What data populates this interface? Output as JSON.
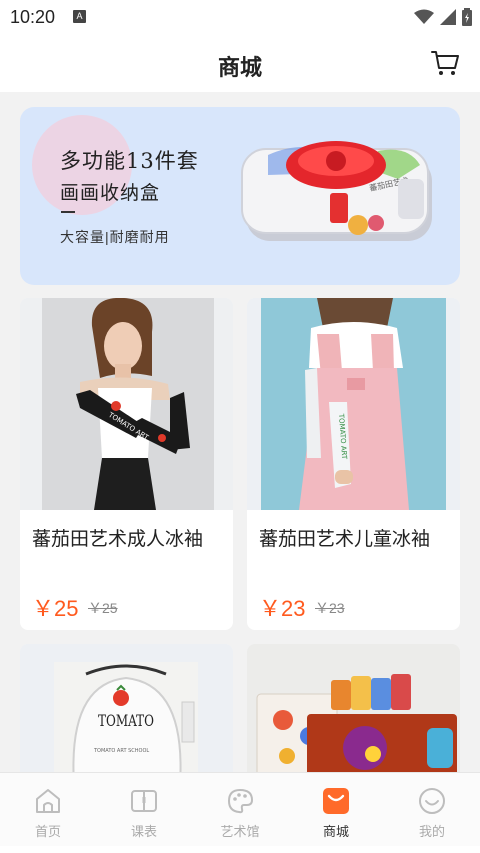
{
  "status_bar": {
    "time": "10:20",
    "badge": "A"
  },
  "header": {
    "title": "商城",
    "cart_icon": "cart-icon"
  },
  "banner": {
    "title_line1": "多功能13件套",
    "title_line2": "画画收纳盒",
    "subtitle": "大容量|耐磨耐用",
    "product_label": "蕃茄田艺术"
  },
  "products": [
    {
      "name": "蕃茄田艺术成人冰袖",
      "price": "￥25",
      "old_price": "￥25",
      "image_text": "TOMATO ART"
    },
    {
      "name": "蕃茄田艺术儿童冰袖",
      "price": "￥23",
      "old_price": "￥23",
      "image_text": "TOMATO ART"
    },
    {
      "name": "",
      "price": "",
      "old_price": "",
      "image_text": "TOMATO",
      "image_subtext": "TOMATO ART SCHOOL"
    },
    {
      "name": "",
      "price": "",
      "old_price": "",
      "image_text": ""
    }
  ],
  "tabs": [
    {
      "label": "首页",
      "icon": "home-icon"
    },
    {
      "label": "课表",
      "icon": "schedule-icon"
    },
    {
      "label": "艺术馆",
      "icon": "palette-icon"
    },
    {
      "label": "商城",
      "icon": "shop-icon",
      "active": true
    },
    {
      "label": "我的",
      "icon": "profile-icon"
    }
  ],
  "colors": {
    "accent": "#ff5a1e",
    "price": "#ff5a1e",
    "banner_bg": "#d8e6fb",
    "active_tab": "#ff6a2a",
    "inactive_tab": "#aaaaaa"
  }
}
